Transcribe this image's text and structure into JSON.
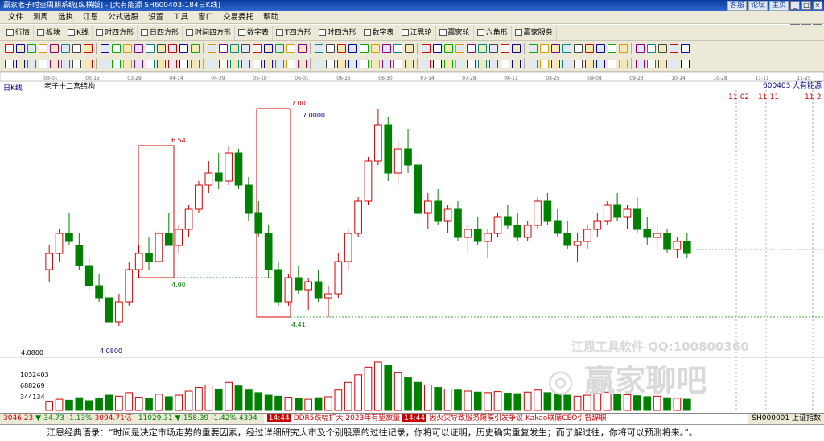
{
  "app": {
    "title": "赢家老子时空周期系统[纵横版] - [大有能源  SH600403-184日K线]",
    "top_links": [
      "客服",
      "论坛",
      "主页"
    ],
    "window_buttons": [
      "_",
      "□",
      "×"
    ],
    "mdi_buttons": [
      "_",
      "□",
      "×"
    ]
  },
  "menu": [
    "文件",
    "测周",
    "选执",
    "江恩",
    "公式选股",
    "设置",
    "工具",
    "窗口",
    "交易委托",
    "帮助"
  ],
  "toolbar1": [
    {
      "icon": "quote-icon",
      "label": "行情"
    },
    {
      "icon": "block-icon",
      "label": "板块"
    },
    {
      "icon": "kline-icon",
      "label": "K线"
    },
    {
      "icon": "square9-icon",
      "label": "时四方形"
    },
    {
      "icon": "square9-icon",
      "label": "日四方形"
    },
    {
      "icon": "square9-icon",
      "label": "时间四方形"
    },
    {
      "icon": "number-icon",
      "label": "数字表"
    },
    {
      "icon": "square9-icon",
      "label": "T四方形"
    },
    {
      "icon": "square9-icon",
      "label": "时四方形"
    },
    {
      "icon": "number-icon",
      "label": "数字表"
    },
    {
      "icon": "gann-wheel-icon",
      "label": "江恩轮"
    },
    {
      "icon": "winner-wheel-icon",
      "label": "赢家轮"
    },
    {
      "icon": "hexagon-icon",
      "label": "六角形"
    },
    {
      "icon": "service-icon",
      "label": "赢家服务"
    }
  ],
  "chart": {
    "period_label": "日K线",
    "indicator_title": "老子十二宫结构",
    "stock_code": "600403",
    "stock_name": "大有能源",
    "future_dates": [
      "11-02",
      "11-11",
      "11-2"
    ],
    "annotations": {
      "high1": "6.54",
      "low1": "4.90",
      "high2": "7.00",
      "high2b": "7.0000",
      "low2": "4.41",
      "low0": "4.0800",
      "axis_low": "4.0800"
    },
    "vol_labels": [
      "1032403",
      "688269",
      "344134"
    ]
  },
  "chart_data": {
    "type": "candlestick",
    "title": "老子十二宫结构",
    "date_ticks": [
      "03-01",
      "03-15",
      "03-29",
      "04-14",
      "04-29",
      "05-18",
      "06-01",
      "06-16",
      "06-30",
      "07-14",
      "07-28",
      "08-11",
      "08-25",
      "09-08",
      "09-23",
      "10-14",
      "10-28",
      "11-11",
      "11-25"
    ],
    "ohlc": [
      [
        5.0,
        5.3,
        4.85,
        5.2
      ],
      [
        5.2,
        5.5,
        5.1,
        5.45
      ],
      [
        5.45,
        5.7,
        5.3,
        5.35
      ],
      [
        5.3,
        5.45,
        5.0,
        5.05
      ],
      [
        5.05,
        5.15,
        4.75,
        4.8
      ],
      [
        4.8,
        4.95,
        4.6,
        4.65
      ],
      [
        4.65,
        4.8,
        4.08,
        4.35
      ],
      [
        4.35,
        4.7,
        4.3,
        4.6
      ],
      [
        4.6,
        5.1,
        4.55,
        5.0
      ],
      [
        5.0,
        5.3,
        4.9,
        5.2
      ],
      [
        5.2,
        5.4,
        5.0,
        5.1
      ],
      [
        5.1,
        5.5,
        5.05,
        5.45
      ],
      [
        5.45,
        5.7,
        5.35,
        5.3
      ],
      [
        5.3,
        5.55,
        5.2,
        5.5
      ],
      [
        5.5,
        5.8,
        5.4,
        5.75
      ],
      [
        5.75,
        6.1,
        5.7,
        6.05
      ],
      [
        6.05,
        6.35,
        5.95,
        6.2
      ],
      [
        6.2,
        6.45,
        6.0,
        6.1
      ],
      [
        6.1,
        6.54,
        6.05,
        6.45
      ],
      [
        6.45,
        6.5,
        6.0,
        6.05
      ],
      [
        6.05,
        6.15,
        5.6,
        5.7
      ],
      [
        5.7,
        5.85,
        5.4,
        5.45
      ],
      [
        5.45,
        5.55,
        4.9,
        5.0
      ],
      [
        5.0,
        5.1,
        4.55,
        4.6
      ],
      [
        4.6,
        4.95,
        4.55,
        4.9
      ],
      [
        4.9,
        5.05,
        4.7,
        4.75
      ],
      [
        4.75,
        4.9,
        4.5,
        4.85
      ],
      [
        4.85,
        5.0,
        4.6,
        4.65
      ],
      [
        4.65,
        4.8,
        4.41,
        4.7
      ],
      [
        4.7,
        5.2,
        4.65,
        5.1
      ],
      [
        5.1,
        5.5,
        5.0,
        5.45
      ],
      [
        5.45,
        5.9,
        5.4,
        5.85
      ],
      [
        5.85,
        6.4,
        5.8,
        6.35
      ],
      [
        6.35,
        7.0,
        6.3,
        6.8
      ],
      [
        6.8,
        6.9,
        6.1,
        6.2
      ],
      [
        6.2,
        6.6,
        6.05,
        6.5
      ],
      [
        6.5,
        6.75,
        6.2,
        6.3
      ],
      [
        6.3,
        6.45,
        5.6,
        5.7
      ],
      [
        5.7,
        5.95,
        5.5,
        5.85
      ],
      [
        5.85,
        6.0,
        5.55,
        5.6
      ],
      [
        5.6,
        5.8,
        5.45,
        5.75
      ],
      [
        5.75,
        5.85,
        5.35,
        5.4
      ],
      [
        5.4,
        5.55,
        5.2,
        5.5
      ],
      [
        5.5,
        5.65,
        5.3,
        5.35
      ],
      [
        5.35,
        5.5,
        5.15,
        5.45
      ],
      [
        5.45,
        5.7,
        5.4,
        5.65
      ],
      [
        5.65,
        5.8,
        5.5,
        5.55
      ],
      [
        5.55,
        5.7,
        5.35,
        5.4
      ],
      [
        5.4,
        5.6,
        5.35,
        5.55
      ],
      [
        5.55,
        5.9,
        5.5,
        5.85
      ],
      [
        5.85,
        5.95,
        5.55,
        5.6
      ],
      [
        5.6,
        5.75,
        5.4,
        5.45
      ],
      [
        5.45,
        5.6,
        5.25,
        5.3
      ],
      [
        5.3,
        5.45,
        5.1,
        5.35
      ],
      [
        5.35,
        5.55,
        5.25,
        5.5
      ],
      [
        5.5,
        5.7,
        5.4,
        5.6
      ],
      [
        5.6,
        5.85,
        5.55,
        5.8
      ],
      [
        5.8,
        5.95,
        5.6,
        5.65
      ],
      [
        5.65,
        5.8,
        5.5,
        5.75
      ],
      [
        5.75,
        5.9,
        5.45,
        5.5
      ],
      [
        5.5,
        5.65,
        5.3,
        5.4
      ],
      [
        5.4,
        5.55,
        5.25,
        5.45
      ],
      [
        5.45,
        5.5,
        5.2,
        5.25
      ],
      [
        5.25,
        5.4,
        5.15,
        5.35
      ],
      [
        5.35,
        5.45,
        5.15,
        5.2
      ]
    ],
    "volume": [
      18,
      22,
      20,
      25,
      19,
      23,
      30,
      28,
      35,
      26,
      24,
      32,
      27,
      30,
      38,
      45,
      50,
      42,
      55,
      48,
      40,
      35,
      30,
      28,
      26,
      24,
      22,
      25,
      27,
      40,
      55,
      70,
      85,
      95,
      88,
      75,
      65,
      55,
      50,
      45,
      42,
      40,
      38,
      36,
      35,
      37,
      34,
      33,
      36,
      40,
      35,
      32,
      30,
      28,
      30,
      33,
      36,
      32,
      31,
      29,
      27,
      28,
      25,
      24,
      22
    ],
    "ylim": [
      4.0,
      7.2
    ]
  }
}
